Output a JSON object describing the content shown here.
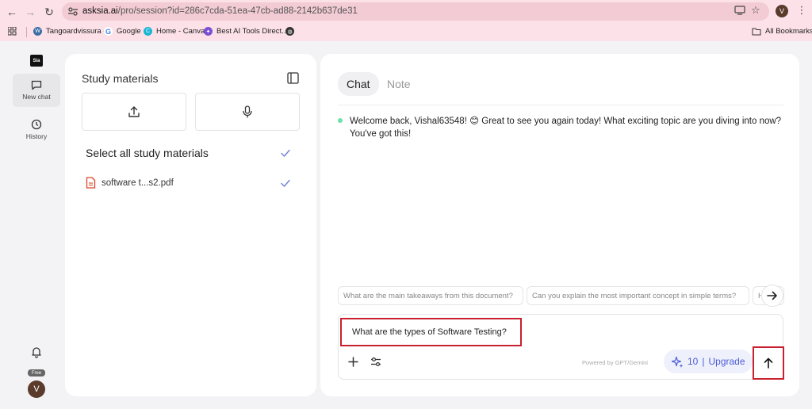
{
  "browser": {
    "url_host": "asksia.ai",
    "url_path": "/pro/session?id=286c7cda-51ea-47cb-ad88-2142b637de31",
    "profile_initial": "V",
    "bookmarks": [
      {
        "label": "Tangoardvissura -",
        "icon": "wordpress-icon"
      },
      {
        "label": "Google",
        "icon": "google-icon"
      },
      {
        "label": "Home - Canva",
        "icon": "canva-icon"
      },
      {
        "label": "Best AI Tools Direct...",
        "icon": "ai-tools-icon"
      },
      {
        "label": "",
        "icon": "globe-icon"
      }
    ],
    "all_bookmarks": "All Bookmarks"
  },
  "rail": {
    "logo": "Sia",
    "new_chat": "New chat",
    "history": "History",
    "plan_badge": "Free",
    "avatar_initial": "V"
  },
  "study": {
    "title": "Study materials",
    "select_all": "Select all study materials",
    "files": [
      {
        "name": "software t...s2.pdf"
      }
    ]
  },
  "chat": {
    "tabs": [
      {
        "label": "Chat",
        "active": true
      },
      {
        "label": "Note",
        "active": false
      }
    ],
    "message": "Welcome back, Vishal63548! 😊 Great to see you again today! What exciting topic are you diving into now? You've got this!",
    "suggestions": [
      "What are the main takeaways from this document?",
      "Can you explain the most important concept in simple terms?",
      "H"
    ],
    "input_value": "What are the types of Software Testing?",
    "powered_by": "Powered by GPT/Gemini",
    "credits": "10",
    "credits_sep": "|",
    "upgrade": "Upgrade"
  },
  "colors": {
    "accent": "#4c5bd4",
    "highlight_box": "#c8202e",
    "online_dot": "#6ee0a8",
    "chrome_bg": "#fce1e8"
  }
}
